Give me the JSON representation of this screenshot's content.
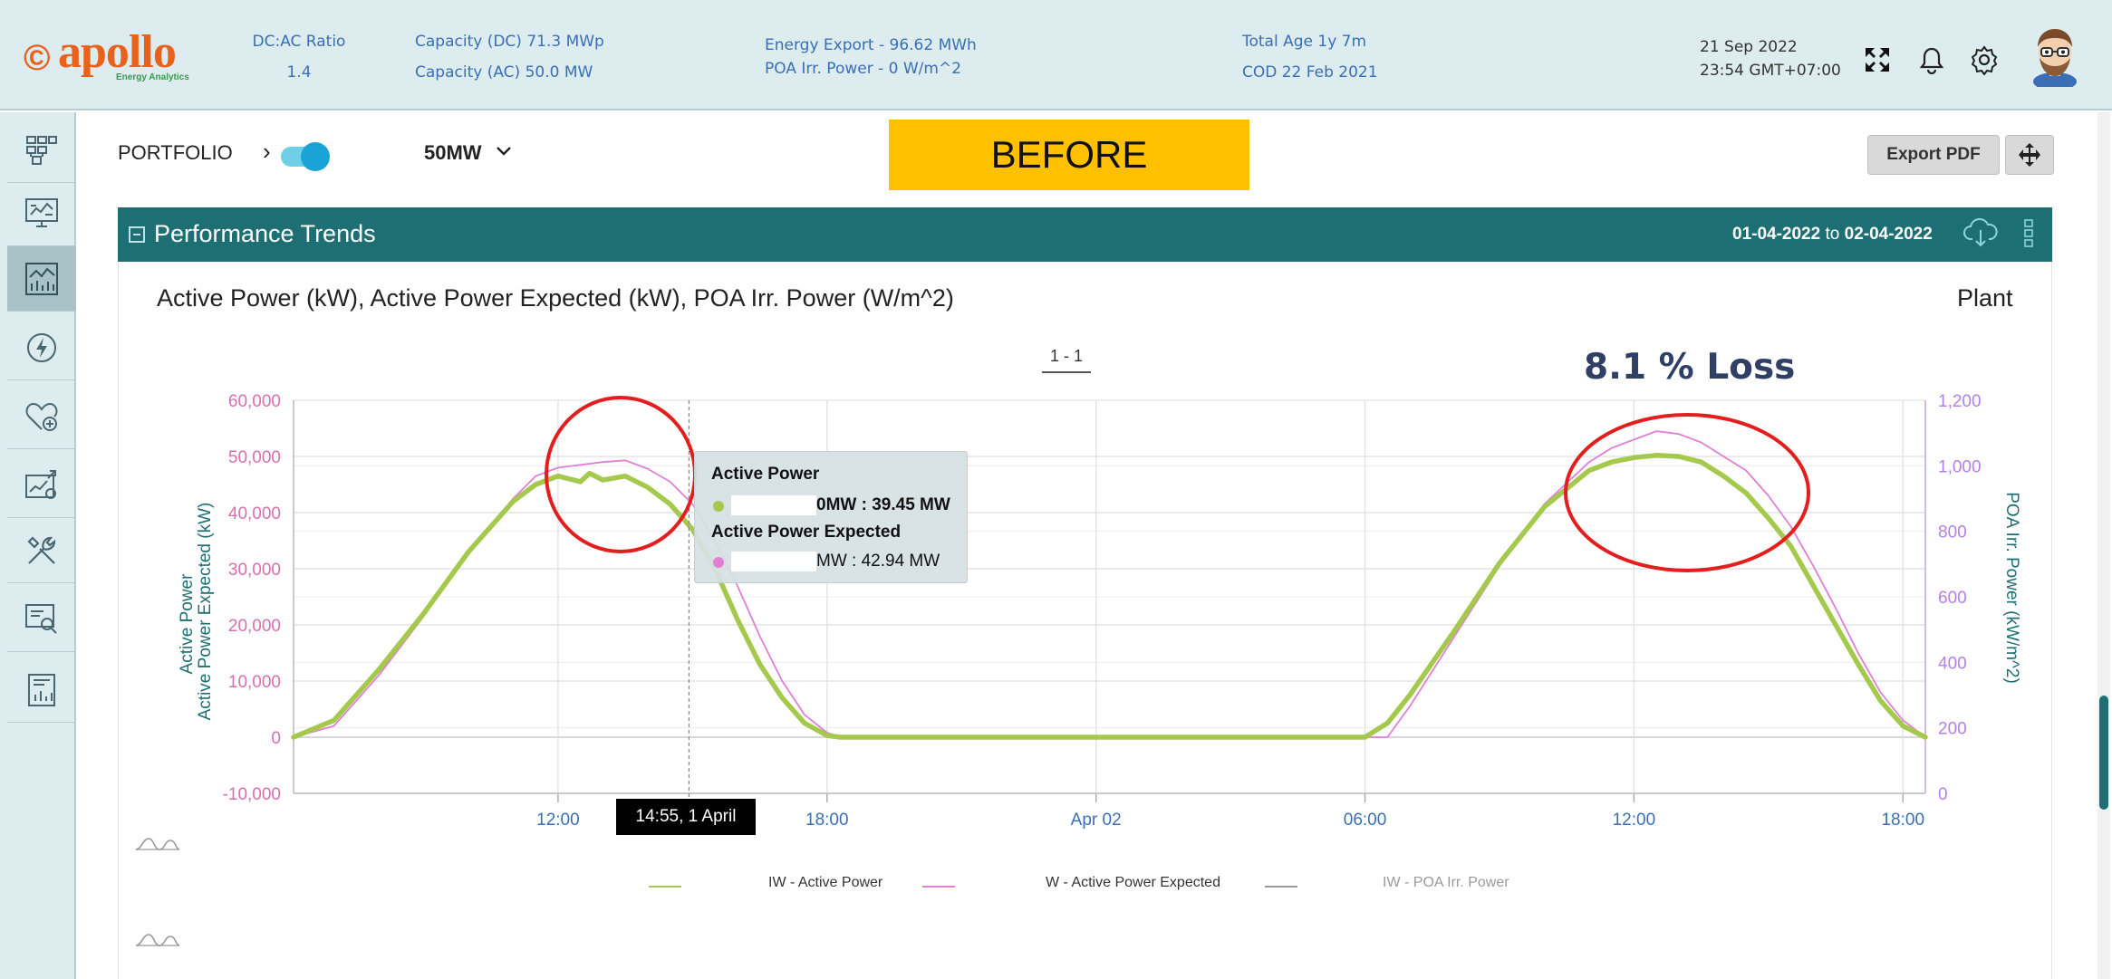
{
  "header": {
    "logo_text": "apollo",
    "logo_sub": "Energy Analytics",
    "dc_ac_label": "DC:AC Ratio",
    "dc_ac_value": "1.4",
    "capacity_dc": "Capacity (DC) 71.3 MWp",
    "capacity_ac": "Capacity (AC) 50.0 MW",
    "energy_export": "Energy Export - 96.62 MWh",
    "poa_irr": "POA Irr. Power - 0 W/m^2",
    "total_age": "Total Age 1y 7m",
    "cod": "COD 22 Feb 2021",
    "date": "21 Sep 2022",
    "time": "23:54 GMT+07:00"
  },
  "sidebar": {
    "items": [
      {
        "icon": "grid-icon"
      },
      {
        "icon": "monitor-icon"
      },
      {
        "icon": "trends-icon",
        "active": true
      },
      {
        "icon": "lightning-icon"
      },
      {
        "icon": "health-icon"
      },
      {
        "icon": "analytics-icon"
      },
      {
        "icon": "tools-icon"
      },
      {
        "icon": "inspect-icon"
      },
      {
        "icon": "report-icon"
      }
    ]
  },
  "toolbar": {
    "portfolio_label": "PORTFOLIO",
    "plant_select": "50MW",
    "banner": "BEFORE",
    "export_label": "Export PDF"
  },
  "panel": {
    "title": "Performance Trends",
    "date_from": "01-04-2022",
    "date_to_word": "to",
    "date_to": "02-04-2022",
    "chart_heading": "Active Power (kW), Active Power Expected (kW), POA Irr. Power (W/m^2)",
    "scope_label": "Plant",
    "pager": "1 - 1",
    "loss_label": "8.1 % Loss"
  },
  "tooltip": {
    "title1": "Active Power",
    "value1": "0MW : 39.45 MW",
    "title2": "Active Power Expected",
    "value2": "MW : 42.94 MW"
  },
  "hover_time": "14:55, 1 April",
  "legend": {
    "items": [
      {
        "label": "IW - Active Power",
        "color": "#a4c94c"
      },
      {
        "label": "W - Active Power Expected",
        "color": "#e17fd5"
      },
      {
        "label": "IW - POA Irr. Power",
        "color": "#9a9a9a"
      }
    ]
  },
  "colors": {
    "header_bg": "#dcecef",
    "panel_bar": "#1e6f73",
    "active_power": "#a4c94c",
    "expected_power": "#e17fd5",
    "poa_axis": "#b57fe6",
    "left_axis_ticks": "#d76fb2",
    "annotation_red": "#e31e1e",
    "banner": "#ffc000"
  },
  "chart_data": {
    "type": "line",
    "ylabel_left": [
      "Active Power",
      "Active Power Expected (kW)"
    ],
    "ylabel_right": "POA Irr. Power (kW/m^2)",
    "y_left_ticks": [
      "60,000",
      "50,000",
      "40,000",
      "30,000",
      "20,000",
      "10,000",
      "0",
      "-10,000"
    ],
    "y_left_range": [
      -10000,
      60000
    ],
    "y_right_ticks": [
      "1,200",
      "1,000",
      "800",
      "600",
      "400",
      "200",
      "0"
    ],
    "y_right_range": [
      0,
      1200
    ],
    "x_ticks": [
      {
        "label": "12:00",
        "h": 12
      },
      {
        "label": "18:00",
        "h": 18
      },
      {
        "label": "Apr 02",
        "h": 24
      },
      {
        "label": "06:00",
        "h": 30
      },
      {
        "label": "12:00",
        "h": 36
      },
      {
        "label": "18:00",
        "h": 42
      }
    ],
    "x_range_hours": [
      6.1,
      42.5
    ],
    "hover_hour": 14.92,
    "grid": true,
    "series": [
      {
        "name": "Active Power",
        "color": "#a4c94c",
        "points": [
          [
            6.1,
            0
          ],
          [
            7,
            3000
          ],
          [
            8,
            12000
          ],
          [
            9,
            22000
          ],
          [
            10,
            33000
          ],
          [
            11,
            42000
          ],
          [
            11.5,
            45000
          ],
          [
            12,
            46500
          ],
          [
            12.5,
            45500
          ],
          [
            12.7,
            47000
          ],
          [
            13,
            45800
          ],
          [
            13.5,
            46500
          ],
          [
            14,
            44500
          ],
          [
            14.5,
            41500
          ],
          [
            15,
            37000
          ],
          [
            15.5,
            30000
          ],
          [
            16,
            21000
          ],
          [
            16.5,
            13000
          ],
          [
            17,
            7000
          ],
          [
            17.5,
            2500
          ],
          [
            18,
            300
          ],
          [
            18.3,
            0
          ],
          [
            30,
            0
          ],
          [
            30.5,
            2500
          ],
          [
            31,
            7500
          ],
          [
            32,
            19000
          ],
          [
            33,
            31000
          ],
          [
            34,
            41000
          ],
          [
            35,
            47500
          ],
          [
            35.5,
            49000
          ],
          [
            36,
            49800
          ],
          [
            36.5,
            50200
          ],
          [
            37,
            50000
          ],
          [
            37.5,
            49000
          ],
          [
            38,
            46500
          ],
          [
            38.5,
            43500
          ],
          [
            39,
            39000
          ],
          [
            39.5,
            34000
          ],
          [
            40,
            27000
          ],
          [
            40.5,
            20000
          ],
          [
            41,
            13000
          ],
          [
            41.5,
            6500
          ],
          [
            42,
            2000
          ],
          [
            42.5,
            0
          ]
        ]
      },
      {
        "name": "Active Power Expected",
        "color": "#e17fd5",
        "points": [
          [
            6.1,
            0
          ],
          [
            7,
            2000
          ],
          [
            8,
            11000
          ],
          [
            9,
            21500
          ],
          [
            10,
            33000
          ],
          [
            11,
            42500
          ],
          [
            11.5,
            46500
          ],
          [
            12,
            48000
          ],
          [
            12.5,
            48500
          ],
          [
            13,
            49000
          ],
          [
            13.5,
            49300
          ],
          [
            14,
            47800
          ],
          [
            14.5,
            45500
          ],
          [
            15,
            41500
          ],
          [
            15.5,
            35000
          ],
          [
            16,
            27000
          ],
          [
            16.5,
            18000
          ],
          [
            17,
            10000
          ],
          [
            17.5,
            4000
          ],
          [
            18,
            800
          ],
          [
            18.3,
            0
          ],
          [
            30.5,
            0
          ],
          [
            31,
            5500
          ],
          [
            32,
            18000
          ],
          [
            33,
            30500
          ],
          [
            34,
            41500
          ],
          [
            35,
            49000
          ],
          [
            35.5,
            51500
          ],
          [
            36,
            53000
          ],
          [
            36.5,
            54500
          ],
          [
            37,
            54000
          ],
          [
            37.5,
            52500
          ],
          [
            38,
            50000
          ],
          [
            38.5,
            47500
          ],
          [
            39,
            43000
          ],
          [
            39.5,
            37500
          ],
          [
            40,
            30500
          ],
          [
            40.5,
            23000
          ],
          [
            41,
            15000
          ],
          [
            41.5,
            8000
          ],
          [
            42,
            3000
          ],
          [
            42.5,
            0
          ]
        ]
      }
    ]
  }
}
